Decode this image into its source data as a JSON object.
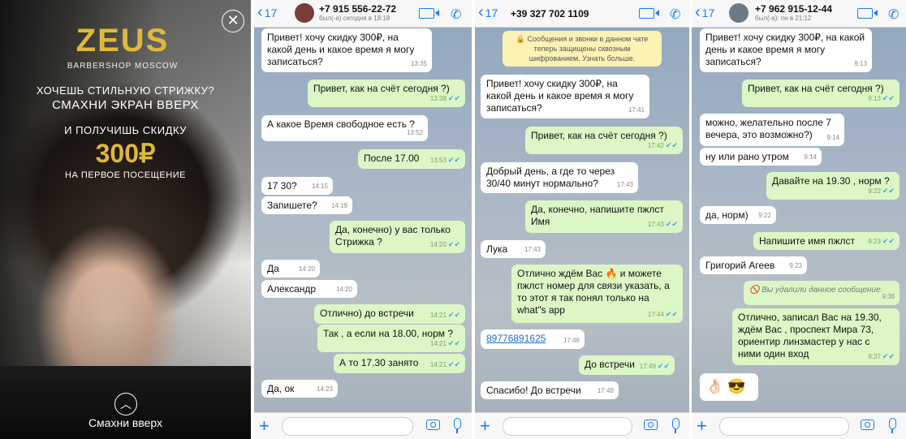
{
  "ad": {
    "logo": "ZEUS",
    "brand_subtitle": "BARBERSHOP MOSCOW",
    "line1": "Хочешь стильную стрижку?",
    "line2": "Смахни экран вверх",
    "line3": "и получишь скидку",
    "price": "300₽",
    "line4": "на первое посещение",
    "swipe_label": "Смахни вверх",
    "accent_color": "#e0b83a",
    "close_icon": "close-icon",
    "up_icon": "chevron-up-icon"
  },
  "chats": [
    {
      "back_label": "17",
      "phone": "+7 915 556-22-72",
      "status": "был(-а) сегодня в 18:18",
      "messages": [
        {
          "text": "Привет! хочу скидку 300₽, на какой день и какое время я могу записаться?",
          "time": "13:35",
          "dir": "in"
        },
        {
          "text": "Привет, как на счёт сегодня ?)",
          "time": "13:38",
          "dir": "out"
        },
        {
          "text": "А какое Время свободное есть ?",
          "time": "13:52",
          "dir": "in"
        },
        {
          "text": "После 17.00",
          "time": "13:53",
          "dir": "out"
        },
        {
          "text": "17 30?",
          "time": "14:15",
          "dir": "in"
        },
        {
          "text": "Запишете?",
          "time": "14:19",
          "dir": "in"
        },
        {
          "text": "Да, конечно) у вас только Стрижка ?",
          "time": "14:20",
          "dir": "out"
        },
        {
          "text": "Да",
          "time": "14:20",
          "dir": "in"
        },
        {
          "text": "Александр",
          "time": "14:20",
          "dir": "in"
        },
        {
          "text": "Отлично) до встречи",
          "time": "14:21",
          "dir": "out"
        },
        {
          "text": "Так , а если на 18.00, норм ?",
          "time": "14:21",
          "dir": "out"
        },
        {
          "text": "А то 17.30 занято",
          "time": "14:21",
          "dir": "out"
        },
        {
          "text": "Да, ок",
          "time": "14:23",
          "dir": "in"
        }
      ]
    },
    {
      "back_label": "17",
      "phone": "+39 327 702 1109",
      "system_notice": "🔒 Сообщения и звонки в данном чате теперь защищены сквозным шифрованием. Узнать больше.",
      "messages": [
        {
          "text": "Привет! хочу скидку 300₽, на какой день и какое время я могу записаться?",
          "time": "17:41",
          "dir": "in"
        },
        {
          "text": "Привет, как на счёт сегодня ?)",
          "time": "17:42",
          "dir": "out"
        },
        {
          "text": "Добрый день, а где то через 30/40 минут нормально?",
          "time": "17:43",
          "dir": "in"
        },
        {
          "text": "Да, конечно, напишите пжлст Имя",
          "time": "17:43",
          "dir": "out"
        },
        {
          "text": "Лука",
          "time": "17:43",
          "dir": "in"
        },
        {
          "text": "Отлично ждём Вас 🔥 и можете пжлст номер для связи указать, а то этот я так понял только на what\"s app",
          "time": "17:44",
          "dir": "out"
        },
        {
          "text": "89776891625",
          "time": "17:46",
          "dir": "in"
        },
        {
          "text": "До встречи",
          "time": "17:49",
          "dir": "out"
        },
        {
          "text": "Спасибо! До встречи",
          "time": "17:49",
          "dir": "in"
        }
      ]
    },
    {
      "back_label": "17",
      "phone": "+7 962 915-12-44",
      "status": "был(-а): пн в 21:12",
      "messages": [
        {
          "text": "Привет! хочу скидку 300₽, на какой день и какое время я могу записаться?",
          "time": "9:13",
          "dir": "in"
        },
        {
          "text": "Привет, как на счёт сегодня ?)",
          "time": "9:13",
          "dir": "out"
        },
        {
          "text": "можно, желательно после 7 вечера, это возможно?)",
          "time": "9:14",
          "dir": "in"
        },
        {
          "text": "ну или рано утром",
          "time": "9:14",
          "dir": "in"
        },
        {
          "text": "Давайте на 19.30 , норм ?",
          "time": "9:22",
          "dir": "out"
        },
        {
          "text": "да, норм)",
          "time": "9:22",
          "dir": "in"
        },
        {
          "text": "Напишите имя пжлст",
          "time": "9:23",
          "dir": "out"
        },
        {
          "text": "Григорий Агеев",
          "time": "9:23",
          "dir": "in"
        },
        {
          "text": "🚫 Вы удалили данное сообщение.",
          "time": "9:36",
          "dir": "deleted"
        },
        {
          "text": "Отлично, записал Вас на 19.30, ждём Вас , проспект Мира 73, ориентир линзмастер у нас с ними один вход",
          "time": "9:37",
          "dir": "out"
        },
        {
          "text": "👌🏻 😎",
          "time": "",
          "dir": "in"
        }
      ]
    }
  ],
  "colors": {
    "accent": "#1a7cf5",
    "outgoing_bubble": "#dcf7c5",
    "incoming_bubble": "#ffffff",
    "read_check": "#3aa0f0"
  }
}
